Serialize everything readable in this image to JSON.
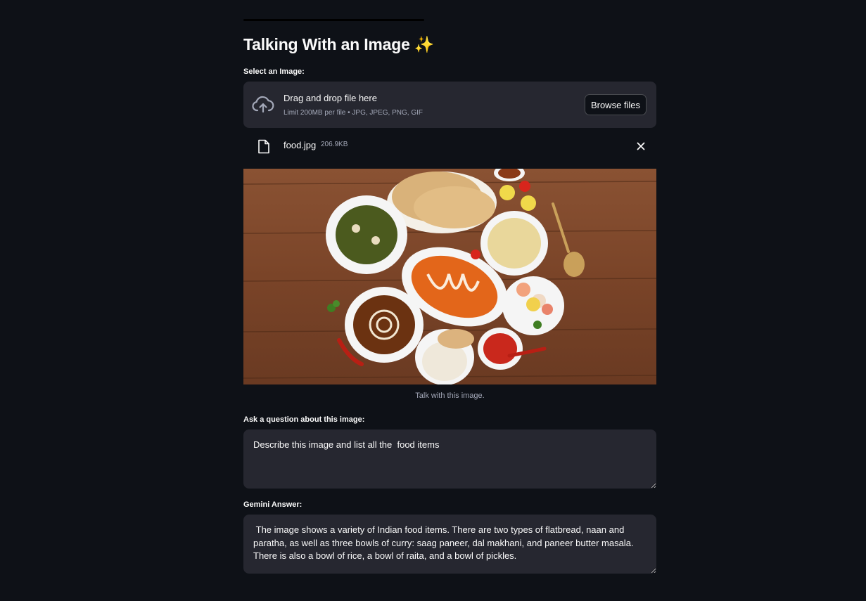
{
  "app": {
    "title": "Talking With an Image ✨"
  },
  "uploader": {
    "label": "Select an Image:",
    "drop_title": "Drag and drop file here",
    "limit_text": "Limit 200MB per file • JPG, JPEG, PNG, GIF",
    "browse_label": "Browse files",
    "icon": "cloud-upload-icon"
  },
  "file": {
    "name": "food.jpg",
    "size": "206.9KB",
    "icon": "file-icon",
    "remove_icon": "close-icon"
  },
  "image": {
    "caption": "Talk with this image."
  },
  "question": {
    "label": "Ask a question about this image:",
    "value": "Describe this image and list all the  food items"
  },
  "answer": {
    "label": "Gemini Answer:",
    "value": " The image shows a variety of Indian food items. There are two types of flatbread, naan and paratha, as well as three bowls of curry: saag paneer, dal makhani, and paneer butter masala. There is also a bowl of rice, a bowl of raita, and a bowl of pickles."
  },
  "colors": {
    "background": "#0e1117",
    "widget": "#262730",
    "text": "#fafafa",
    "muted": "#a3a8b8"
  }
}
